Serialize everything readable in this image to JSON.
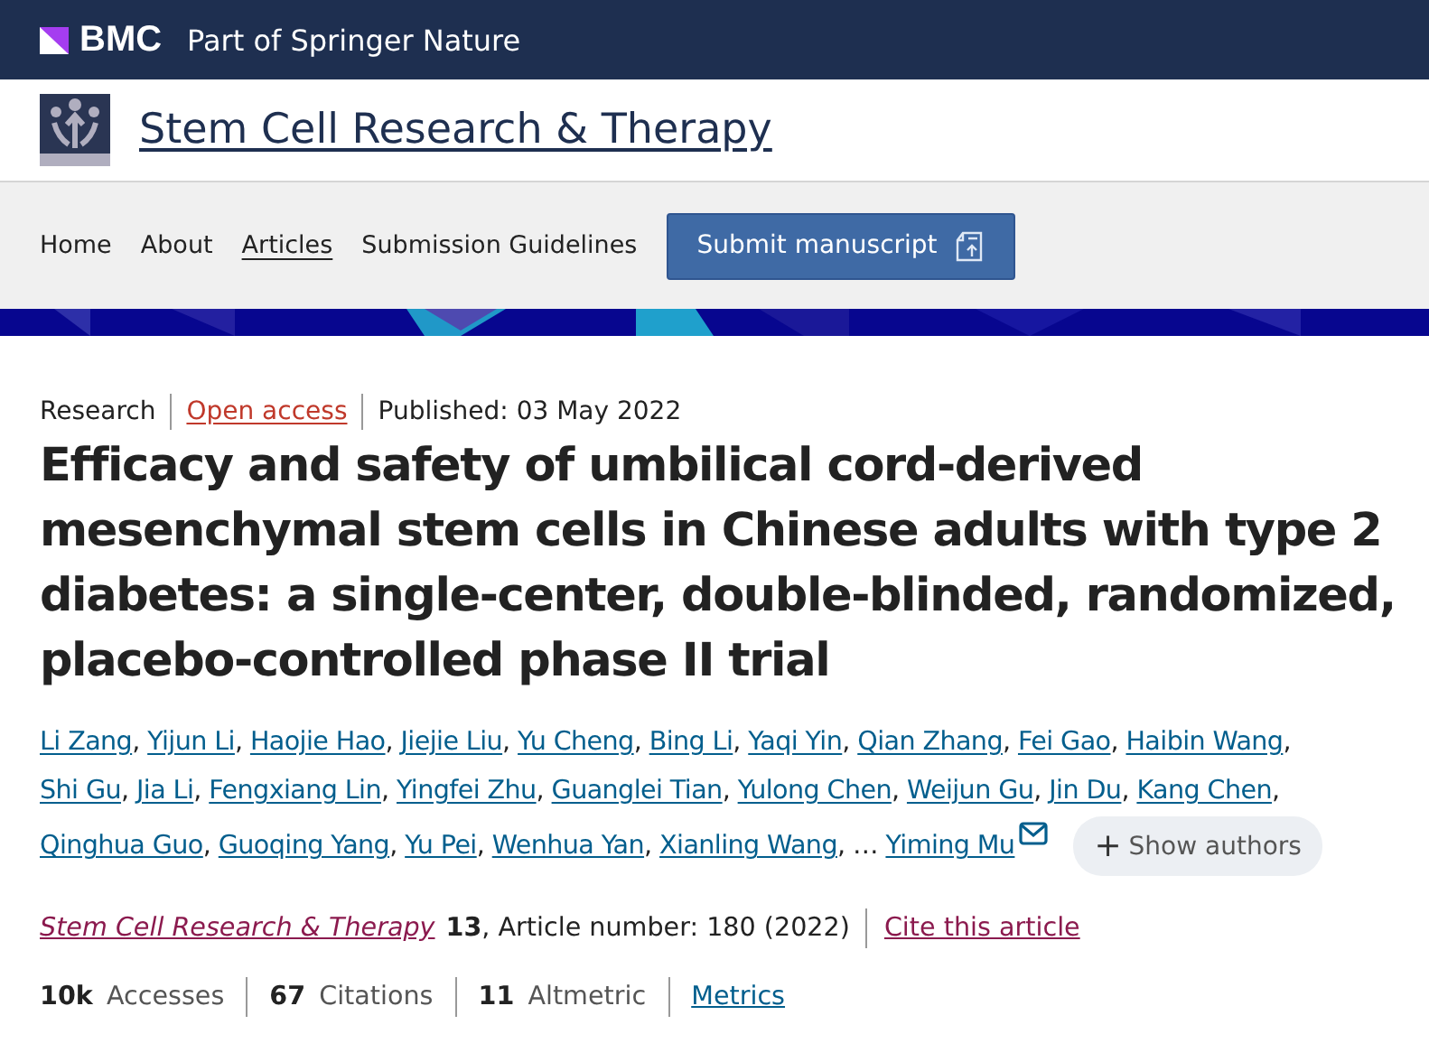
{
  "top_bar": {
    "brand": "BMC",
    "tagline": "Part of Springer Nature"
  },
  "journal": {
    "title": "Stem Cell Research & Therapy"
  },
  "nav": {
    "items": [
      {
        "label": "Home",
        "selected": false
      },
      {
        "label": "About",
        "selected": false
      },
      {
        "label": "Articles",
        "selected": true
      },
      {
        "label": "Submission Guidelines",
        "selected": false
      }
    ],
    "submit_button": "Submit manuscript"
  },
  "article": {
    "type": "Research",
    "access": "Open access",
    "published": "Published: 03 May 2022",
    "title": "Efficacy and safety of umbilical cord-derived mesenchymal stem cells in Chinese adults with type 2 diabetes: a single-center, double-blinded, randomized, placebo-controlled phase II trial",
    "authors": [
      "Li Zang",
      "Yijun Li",
      "Haojie Hao",
      "Jiejie Liu",
      "Yu Cheng",
      "Bing Li",
      "Yaqi Yin",
      "Qian Zhang",
      "Fei Gao",
      "Haibin Wang",
      "Shi Gu",
      "Jia Li",
      "Fengxiang Lin",
      "Yingfei Zhu",
      "Guanglei Tian",
      "Yulong Chen",
      "Weijun Gu",
      "Jin Du",
      "Kang Chen",
      "Qinghua Guo",
      "Guoqing Yang",
      "Yu Pei",
      "Wenhua Yan",
      "Xianling Wang"
    ],
    "author_separator": ",",
    "truncation": "…",
    "corresponding_author": "Yiming Mu",
    "show_authors": "Show authors",
    "show_authors_icon": "+",
    "journal_link": "Stem Cell Research & Therapy",
    "volume": "13",
    "article_number": ", Article number: 180 (2022)",
    "cite": "Cite this article",
    "metrics": [
      "**10k** Accesses",
      "**67** Citations",
      "**11** Altmetric"
    ],
    "metrics_link": "Metrics"
  }
}
